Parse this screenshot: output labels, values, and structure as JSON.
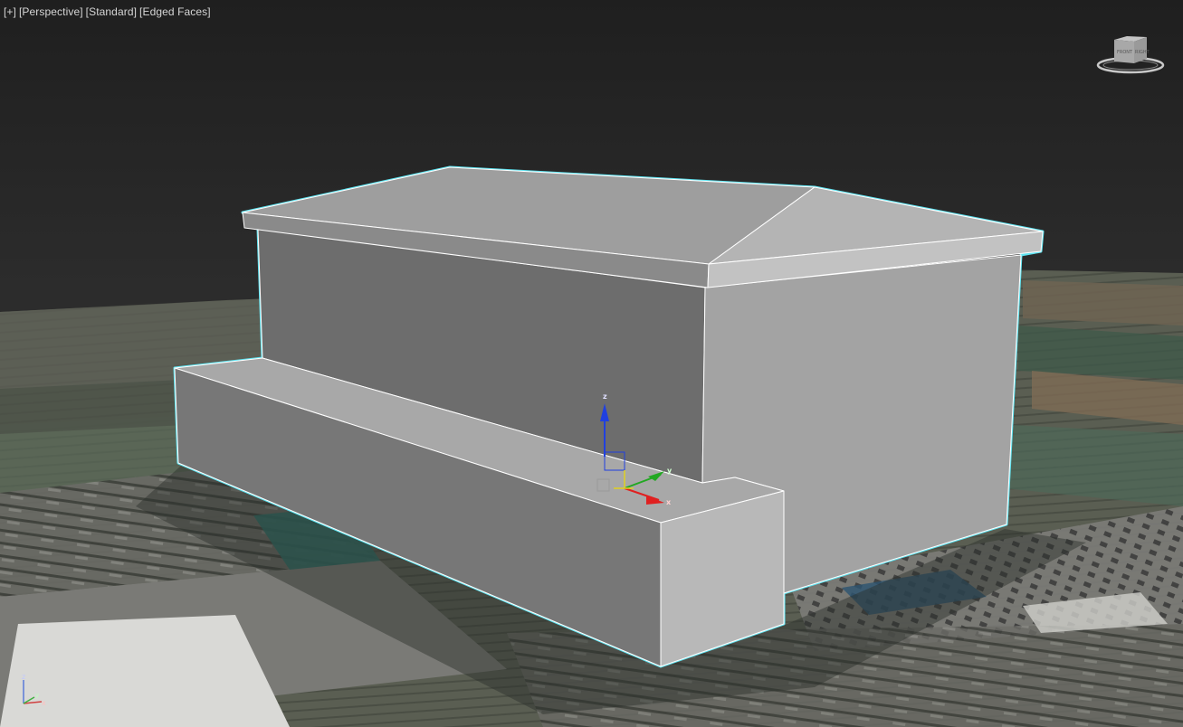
{
  "viewport": {
    "labels": [
      "[+]",
      "[Perspective]",
      "[Standard]",
      "[Edged Faces]"
    ]
  },
  "viewcube": {
    "front": "FRONT",
    "right": "RIGHT"
  },
  "gizmo": {
    "x": "x",
    "y": "y",
    "z": "z"
  },
  "world_axis": {
    "x": "x",
    "y": "y",
    "z": "z"
  },
  "colors": {
    "selection": "#5fe3f0",
    "axis_x": "#e02020",
    "axis_y": "#22a822",
    "axis_z": "#2040e0"
  }
}
